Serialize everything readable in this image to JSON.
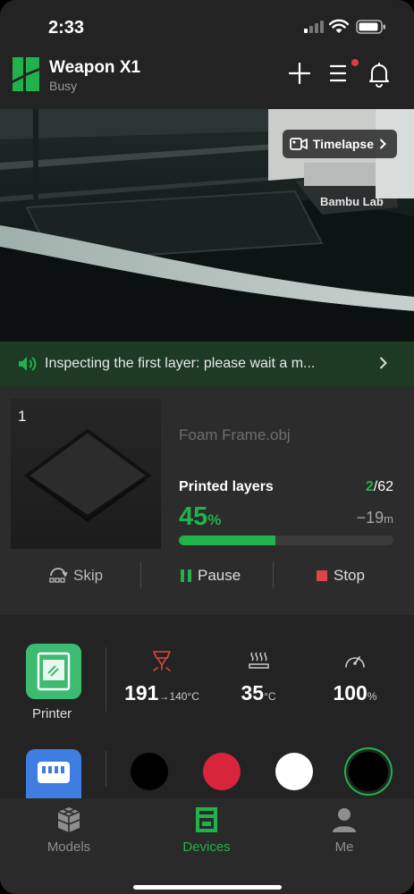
{
  "status_bar": {
    "time": "2:33"
  },
  "header": {
    "title": "Weapon X1",
    "subtitle": "Busy"
  },
  "camera": {
    "timelapse_label": "Timelapse",
    "brand_text": "Bambu Lab"
  },
  "banner": {
    "message": "Inspecting the first layer: please wait a m..."
  },
  "print": {
    "plate_number": "1",
    "file_name": "Foam Frame.obj",
    "layers_label": "Printed layers",
    "layer_current": "2",
    "layer_total": "/62",
    "progress_value": "45",
    "progress_unit": "%",
    "progress_fraction": 0.45,
    "remaining_value": "−19",
    "remaining_unit": "m",
    "actions": {
      "skip": "Skip",
      "pause": "Pause",
      "stop": "Stop"
    }
  },
  "device": {
    "printer_label": "Printer",
    "nozzle_temp": "191",
    "nozzle_target": "→140°C",
    "bed_temp": "35",
    "bed_unit": "°C",
    "speed": "100",
    "speed_unit": "%",
    "spools": [
      {
        "color": "#000000",
        "selected": false
      },
      {
        "color": "#d8253c",
        "selected": false
      },
      {
        "color": "#ffffff",
        "selected": false
      },
      {
        "color": "#000000",
        "selected": true
      }
    ]
  },
  "tabs": [
    {
      "label": "Models",
      "active": false
    },
    {
      "label": "Devices",
      "active": true
    },
    {
      "label": "Me",
      "active": false
    }
  ],
  "colors": {
    "accent": "#21b24c",
    "banner_bg": "#1e3a24",
    "stop_red": "#e04545",
    "printer_tile": "#3dbb71",
    "ams_tile": "#3d7ee0"
  },
  "icons": [
    "signal-icon",
    "wifi-icon",
    "battery-icon",
    "bambu-logo-icon",
    "plus-icon",
    "menu-icon",
    "bell-icon",
    "camera-icon",
    "chevron-right-icon",
    "speaker-icon",
    "skip-icon",
    "pause-icon",
    "stop-icon",
    "printer-icon",
    "nozzle-icon",
    "heatbed-icon",
    "speed-gauge-icon",
    "ams-icon",
    "cube-icon",
    "printer-tab-icon",
    "person-icon"
  ]
}
